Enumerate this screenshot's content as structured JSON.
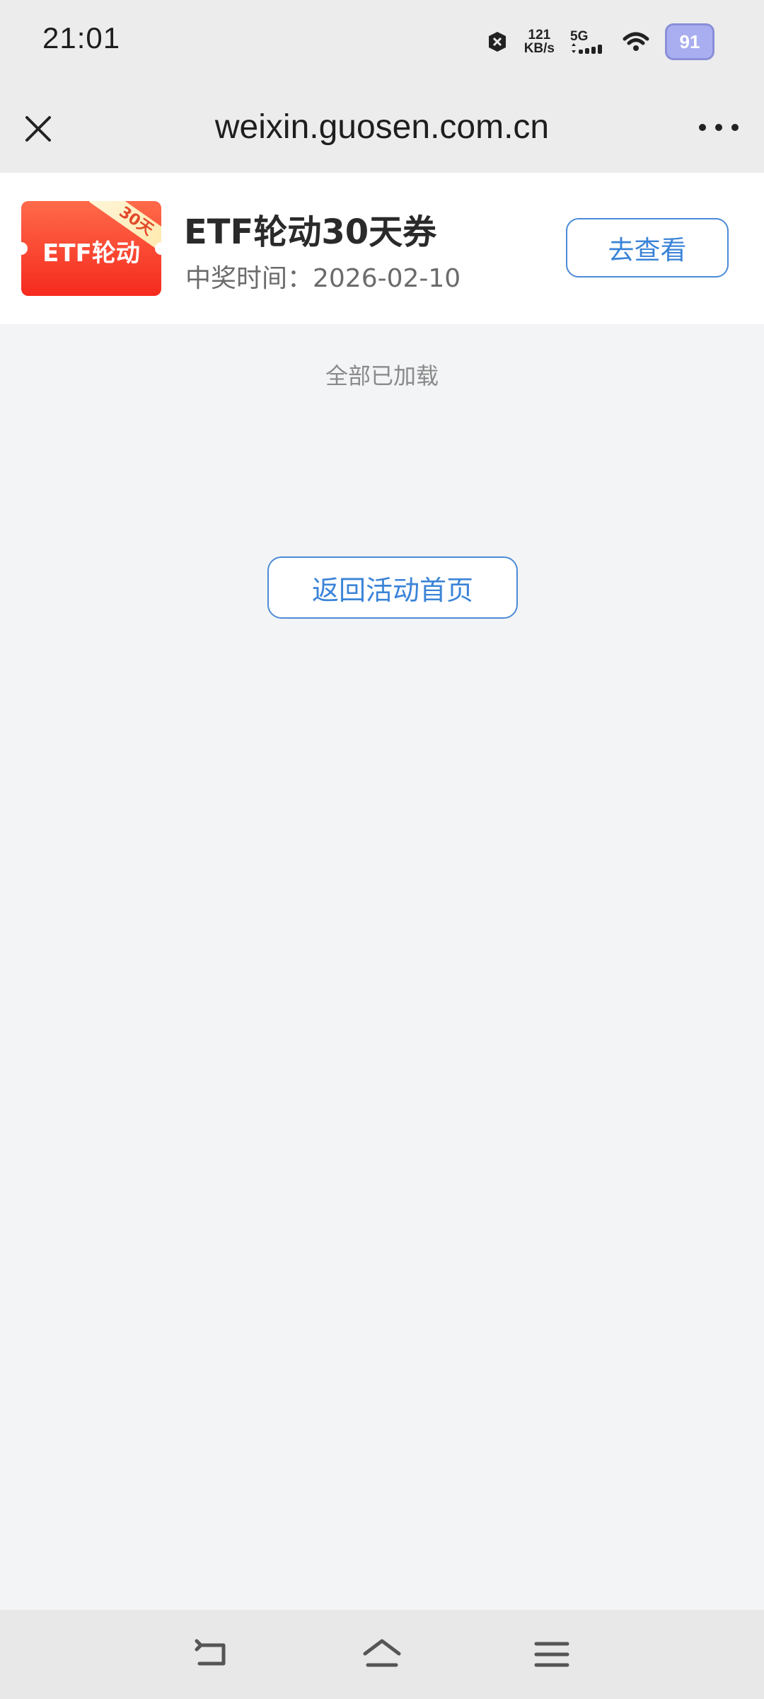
{
  "status_bar": {
    "time": "21:01",
    "net_speed_value": "121",
    "net_speed_unit": "KB/s",
    "signal_label": "5G",
    "battery": "91",
    "icons": [
      "notification-off-icon",
      "signal-icon",
      "wifi-icon",
      "battery-icon"
    ]
  },
  "title_bar": {
    "url": "weixin.guosen.com.cn",
    "close_icon": "close-icon",
    "more_icon": "more-icon"
  },
  "prize_card": {
    "ticket_label": "ETF轮动",
    "ticket_ribbon": "30天",
    "title": "ETF轮动30天券",
    "date": "中奖时间：2026-02-10",
    "view_button": "去查看"
  },
  "list_footer": "全部已加载",
  "back_button": "返回活动首页",
  "nav_bar": {
    "icons": [
      "back-icon",
      "home-icon",
      "menu-icon"
    ]
  }
}
